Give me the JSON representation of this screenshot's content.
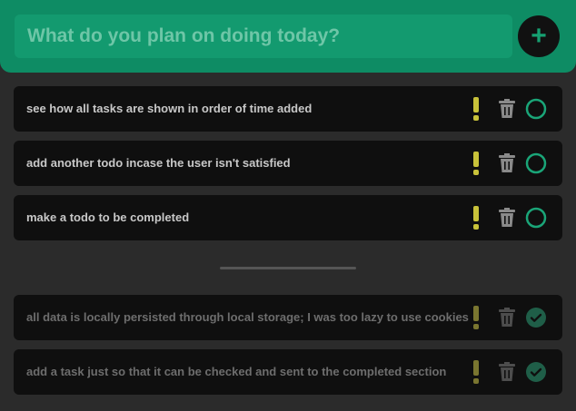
{
  "header": {
    "placeholder": "What do you plan on doing today?",
    "add_icon": "plus-icon"
  },
  "colors": {
    "accent": "#0e8c64",
    "priority": "#c8c23a",
    "check": "#1aa578",
    "background": "#2b2b2b",
    "card": "#0f0f0f"
  },
  "tasks": [
    {
      "text": "see how all tasks are shown in order of time added"
    },
    {
      "text": "add another todo incase the user isn't satisfied"
    },
    {
      "text": "make a todo to be completed"
    }
  ],
  "completed": [
    {
      "text": "all data is locally persisted through local storage; I was too lazy to use cookies"
    },
    {
      "text": "add a task just so that it can be checked and sent to the completed section"
    }
  ]
}
